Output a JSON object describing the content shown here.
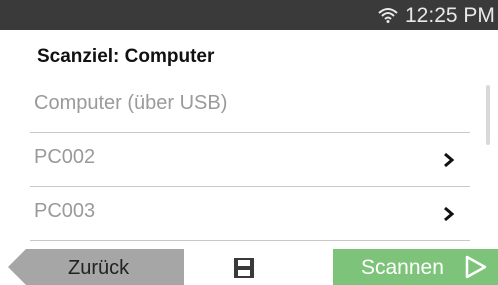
{
  "status_bar": {
    "time": "12:25 PM",
    "wifi_icon": "wifi-icon"
  },
  "header": {
    "title": "Scanziel: Computer"
  },
  "list": {
    "items": [
      {
        "label": "Computer (über USB)",
        "icon": ""
      },
      {
        "label": "PC002",
        "icon": "chevron-right-icon"
      },
      {
        "label": "PC003",
        "icon": "chevron-right-icon"
      }
    ]
  },
  "footer": {
    "back_label": "Zurück",
    "save_icon": "save-icon",
    "scan_label": "Scannen",
    "scan_icon": "play-outline-icon"
  },
  "colors": {
    "status_bar_bg": "#3a3a3a",
    "back_button_bg": "#a6a6a6",
    "scan_button_bg": "#7dc47a",
    "muted_text": "#9a9a9a"
  }
}
